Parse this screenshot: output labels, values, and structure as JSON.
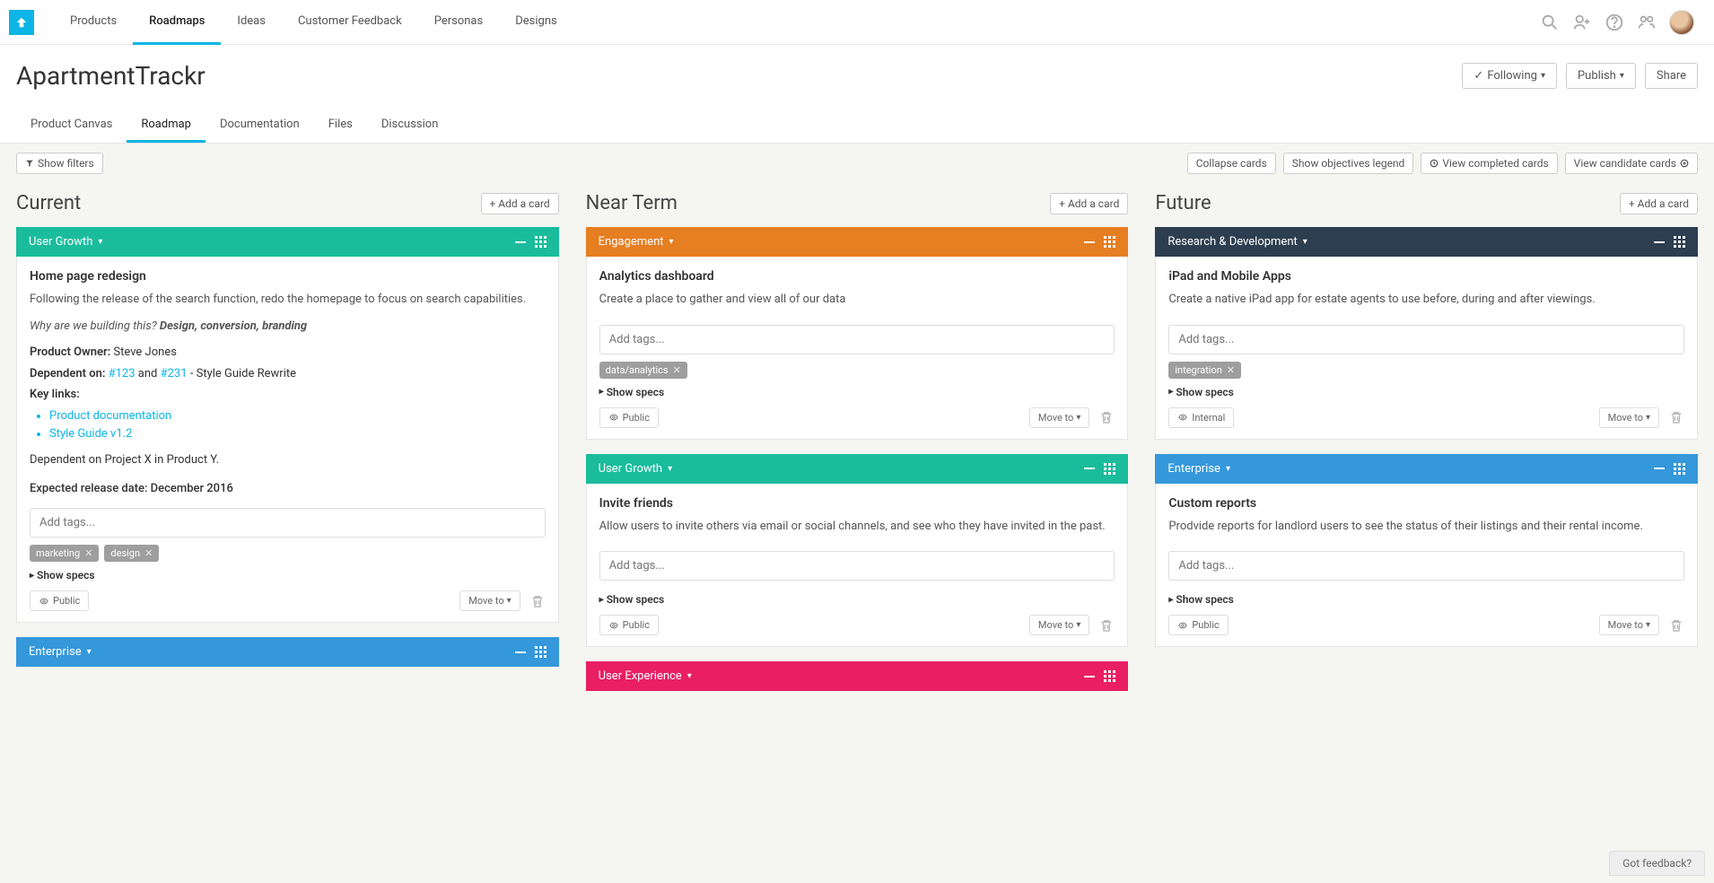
{
  "nav": {
    "items": [
      "Products",
      "Roadmaps",
      "Ideas",
      "Customer Feedback",
      "Personas",
      "Designs"
    ],
    "active": 1
  },
  "page": {
    "title": "ApartmentTrackr",
    "follow_label": "Following",
    "publish_label": "Publish",
    "share_label": "Share"
  },
  "subtabs": {
    "items": [
      "Product Canvas",
      "Roadmap",
      "Documentation",
      "Files",
      "Discussion"
    ],
    "active": 1
  },
  "toolbar": {
    "show_filters": "Show filters",
    "collapse": "Collapse cards",
    "legend": "Show objectives legend",
    "completed": "View completed cards",
    "candidate": "View candidate cards"
  },
  "common": {
    "add_card": "+ Add a card",
    "add_tags_placeholder": "Add tags...",
    "show_specs": "Show specs",
    "move_to": "Move to",
    "public": "Public",
    "internal": "Internal"
  },
  "columns": [
    {
      "title": "Current"
    },
    {
      "title": "Near Term"
    },
    {
      "title": "Future"
    }
  ],
  "cards": {
    "home_redesign": {
      "title": "Home page redesign",
      "desc": "Following the release of the search function, redo the homepage to focus on search capabilities.",
      "why_prefix": "Why are we building this? ",
      "why_answer": "Design, conversion, branding",
      "owner_label": "Product Owner:",
      "owner": "Steve Jones",
      "dep_label": "Dependent on:",
      "dep_link1": "#123",
      "dep_and": "and",
      "dep_link2": "#231",
      "dep_suffix": "- Style Guide Rewrite",
      "keylinks_label": "Key links:",
      "links": [
        "Product documentation",
        "Style Guide v1.2"
      ],
      "dep_project": "Dependent on Project X in Product Y.",
      "release": "Expected release date: December 2016",
      "tags": [
        "marketing",
        "design"
      ]
    },
    "analytics": {
      "title": "Analytics dashboard",
      "desc": "Create a place to gather and view all of our data",
      "tags": [
        "data/analytics"
      ]
    },
    "ipad": {
      "title": "iPad and Mobile Apps",
      "desc": "Create a native iPad app for estate agents to use before, during and after viewings.",
      "tags": [
        "integration"
      ]
    },
    "invite": {
      "title": "Invite friends",
      "desc": "Allow users to invite others via email or social channels, and see who they have invited in the past."
    },
    "reports": {
      "title": "Custom reports",
      "desc": "Prodvide reports for landlord users to see the status of their listings and their rental income."
    }
  },
  "objectives": {
    "user_growth": "User Growth",
    "engagement": "Engagement",
    "rd": "Research & Development",
    "enterprise": "Enterprise",
    "ux": "User Experience"
  },
  "feedback": "Got feedback?"
}
